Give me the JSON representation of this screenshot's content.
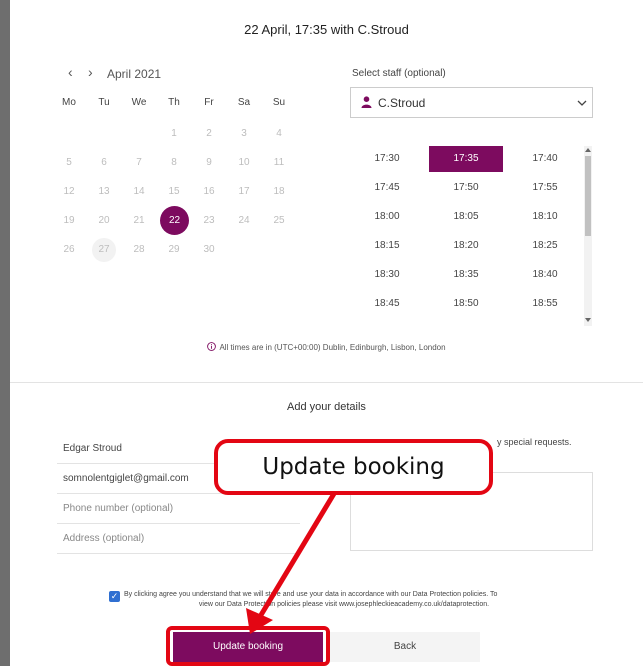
{
  "header": {
    "title": "22 April, 17:35 with C.Stroud"
  },
  "calendar": {
    "prev_glyph": "‹",
    "next_glyph": "›",
    "month_label": "April 2021",
    "weekdays": [
      "Mo",
      "Tu",
      "We",
      "Th",
      "Fr",
      "Sa",
      "Su"
    ],
    "weeks": [
      [
        "",
        "",
        "",
        "1",
        "2",
        "3",
        "4"
      ],
      [
        "5",
        "6",
        "7",
        "8",
        "9",
        "10",
        "11"
      ],
      [
        "12",
        "13",
        "14",
        "15",
        "16",
        "17",
        "18"
      ],
      [
        "19",
        "20",
        "21",
        "22",
        "23",
        "24",
        "25"
      ],
      [
        "26",
        "27",
        "28",
        "29",
        "30",
        "",
        ""
      ]
    ],
    "selected_day": "22",
    "highlighted_day": "27"
  },
  "staff": {
    "caption": "Select staff (optional)",
    "selected": "C.Stroud",
    "icon": "person-icon",
    "chevron": "chevron-down-icon"
  },
  "times": {
    "slots": [
      [
        "17:30",
        "17:35",
        "17:40"
      ],
      [
        "17:45",
        "17:50",
        "17:55"
      ],
      [
        "18:00",
        "18:05",
        "18:10"
      ],
      [
        "18:15",
        "18:20",
        "18:25"
      ],
      [
        "18:30",
        "18:35",
        "18:40"
      ],
      [
        "18:45",
        "18:50",
        "18:55"
      ]
    ],
    "selected": "17:35"
  },
  "timezone_note": "All times are in (UTC+00:00) Dublin, Edinburgh, Lisbon, London",
  "details": {
    "title": "Add your details",
    "name_value": "Edgar Stroud",
    "email_value": "somnolentgiglet@gmail.com",
    "phone_placeholder": "Phone number (optional)",
    "address_placeholder": "Address (optional)",
    "requests_label_visible": "y special requests."
  },
  "consent": {
    "checked": true,
    "line1": "By clicking agree you understand that we will store and use your data in accordance with our Data Protection policies. To",
    "line2": "view our Data Protection policies please visit www.josephleckieacademy.co.uk/dataprotection."
  },
  "buttons": {
    "update_label": "Update booking",
    "back_label": "Back"
  },
  "annotation": {
    "callout_text": "Update booking",
    "color": "#e30613"
  },
  "colors": {
    "accent": "#7d0b5f",
    "annotation": "#e30613",
    "checkbox": "#2f6fd1"
  }
}
